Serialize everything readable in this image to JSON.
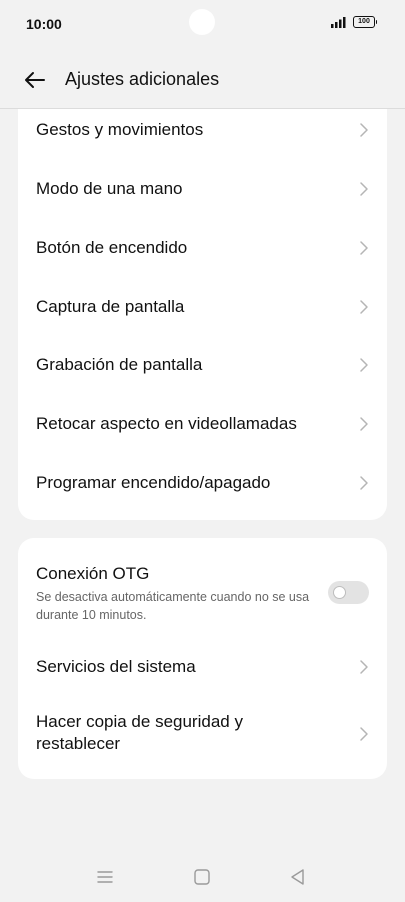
{
  "status_bar": {
    "time": "10:00",
    "battery": "100"
  },
  "header": {
    "title": "Ajustes adicionales"
  },
  "card1": {
    "items": [
      {
        "label": "Gestos y movimientos"
      },
      {
        "label": "Modo de una mano"
      },
      {
        "label": "Botón de encendido"
      },
      {
        "label": "Captura de pantalla"
      },
      {
        "label": "Grabación de pantalla"
      },
      {
        "label": "Retocar aspecto en videollamadas"
      },
      {
        "label": "Programar encendido/apagado"
      }
    ]
  },
  "card2": {
    "otg": {
      "label": "Conexión OTG",
      "description": "Se desactiva automáticamente cuando no se usa durante 10 minutos.",
      "enabled": false
    },
    "items": [
      {
        "label": "Servicios del sistema"
      },
      {
        "label": "Hacer copia de seguridad y restablecer"
      }
    ]
  },
  "colors": {
    "background": "#f2f2f2",
    "card": "#ffffff",
    "chevron": "#b5b5b5",
    "toggle_off": "#e3e3e3"
  }
}
